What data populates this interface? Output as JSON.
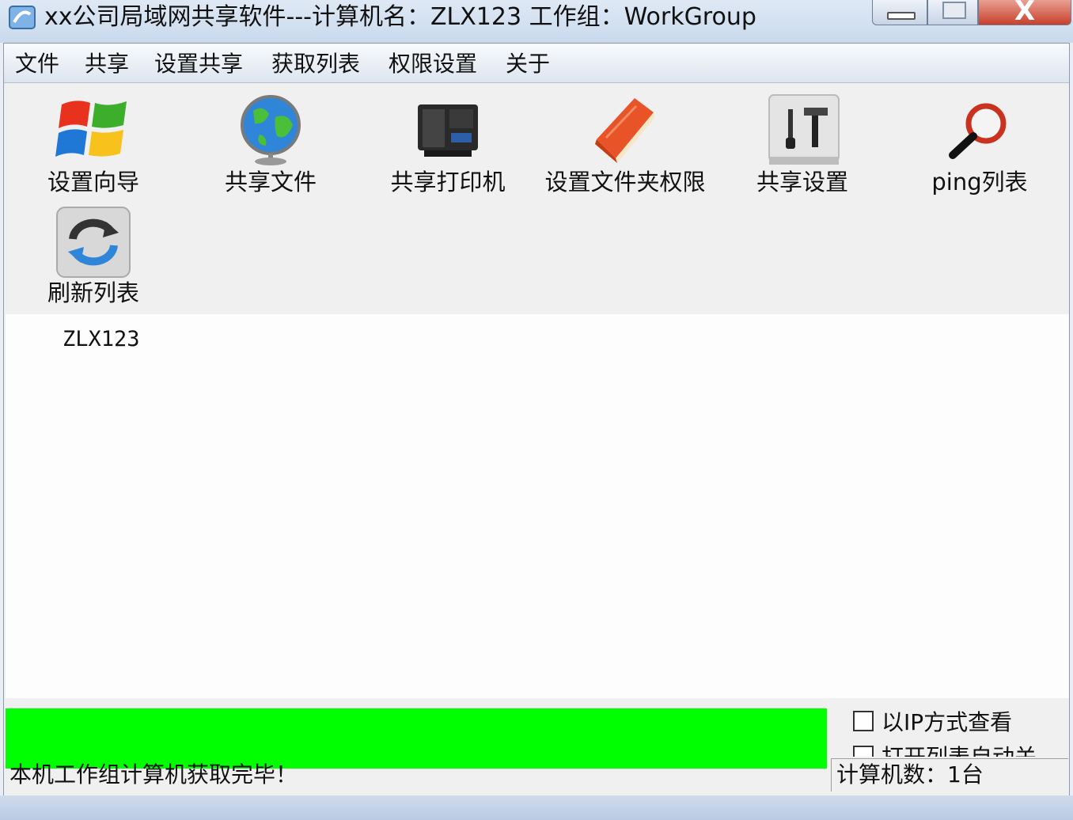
{
  "window": {
    "title": "xx公司局域网共享软件---计算机名：ZLX123  工作组：WorkGroup",
    "close_glyph": "X"
  },
  "menu": [
    "文件",
    "共享",
    "设置共享",
    "获取列表",
    "权限设置",
    "关于"
  ],
  "toolbar": [
    {
      "label": "设置向导",
      "icon": "windows-logo-icon"
    },
    {
      "label": "共享文件",
      "icon": "globe-icon"
    },
    {
      "label": "共享打印机",
      "icon": "printer-icon"
    },
    {
      "label": "设置文件夹权限",
      "icon": "folder-book-icon"
    },
    {
      "label": "共享设置",
      "icon": "tools-icon"
    },
    {
      "label": "ping列表",
      "icon": "magnifier-icon"
    },
    {
      "label": "刷新列表",
      "icon": "refresh-icon"
    }
  ],
  "computers": [
    "ZLX123"
  ],
  "progress": {
    "percent": 100,
    "color": "#00ff00"
  },
  "status": {
    "text": "本机工作组计算机获取完毕！"
  },
  "options": {
    "view_by_ip": {
      "label": "以IP方式查看",
      "checked": false
    },
    "auto_close": {
      "label": "打开列表自动关",
      "checked": false
    }
  },
  "count": {
    "text": "计算机数：1台"
  }
}
